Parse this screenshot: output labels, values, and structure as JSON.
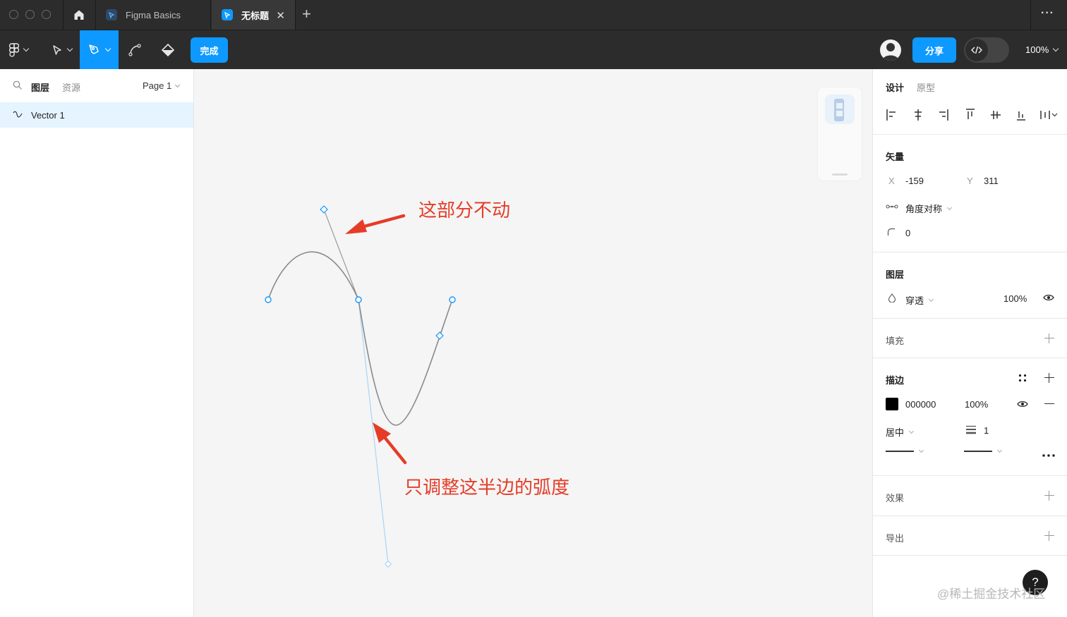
{
  "tabs": [
    {
      "label": "Figma Basics",
      "active": false
    },
    {
      "label": "无标题",
      "active": true
    }
  ],
  "toolbar": {
    "done_label": "完成",
    "share_label": "分享",
    "zoom": "100%"
  },
  "left_panel": {
    "tabs": [
      "图层",
      "资源"
    ],
    "page": "Page 1",
    "layers": [
      {
        "name": "Vector 1",
        "selected": true
      }
    ]
  },
  "canvas": {
    "annotations": [
      "这部分不动",
      "只调整这半边的弧度"
    ]
  },
  "right_panel": {
    "tabs": [
      "设计",
      "原型"
    ],
    "vector": {
      "title": "矢量",
      "x_label": "X",
      "x": "-159",
      "y_label": "Y",
      "y": "311",
      "mirroring": "角度对称",
      "corner_radius": "0"
    },
    "layer": {
      "title": "图层",
      "blend": "穿透",
      "opacity": "100%"
    },
    "fill": {
      "title": "填充"
    },
    "stroke": {
      "title": "描边",
      "color": "000000",
      "opacity": "100%",
      "position": "居中",
      "weight": "1"
    },
    "effects": {
      "title": "效果"
    },
    "export": {
      "title": "导出"
    }
  },
  "help_label": "?",
  "watermark": "@稀土掘金技术社区",
  "colors": {
    "accent": "#0d99ff",
    "annotation": "#e53c28",
    "toolbar_bg": "#2c2c2c"
  }
}
